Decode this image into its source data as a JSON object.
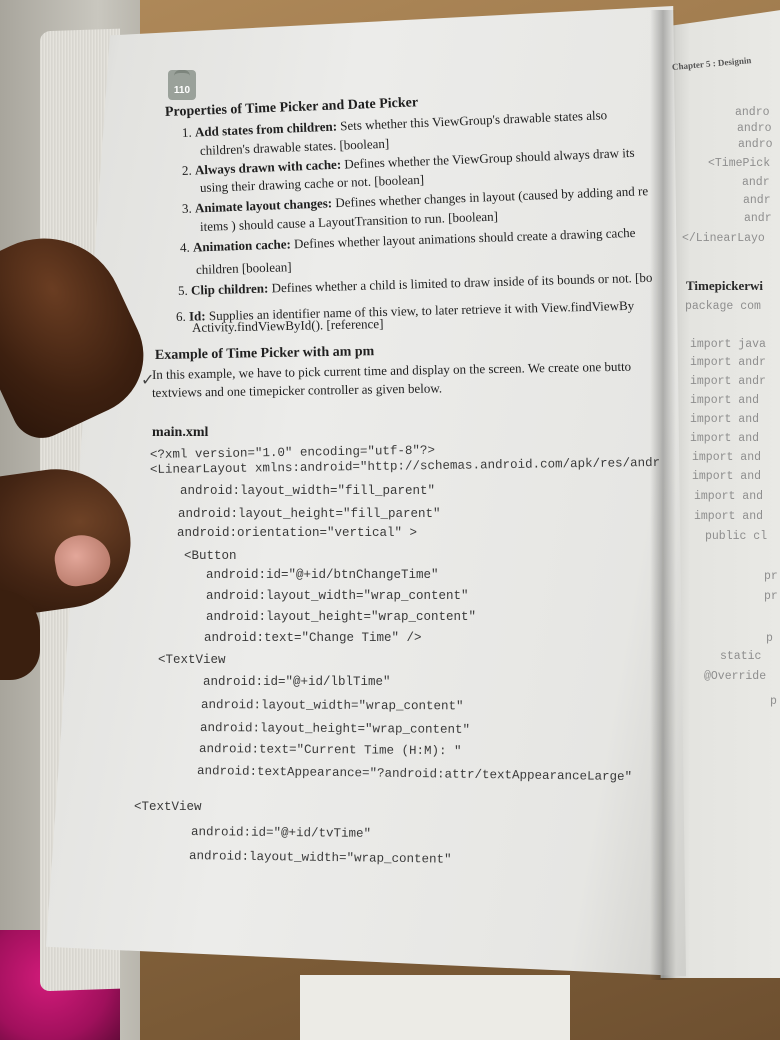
{
  "page_number": "110",
  "header_right": "Chapter 5 : Designin",
  "section_title": "Properties of Time Picker and Date Picker",
  "properties": [
    {
      "num": "1.",
      "term": "Add states from children:",
      "text": " Sets whether this ViewGroup's drawable states also ",
      "cont": "children's drawable states. [boolean]"
    },
    {
      "num": "2.",
      "term": "Always drawn with cache:",
      "text": " Defines whether the ViewGroup should always draw its ",
      "cont": "using their drawing cache or not. [boolean]"
    },
    {
      "num": "3.",
      "term": "Animate layout changes:",
      "text": " Defines whether changes in layout (caused by adding and re",
      "cont": "items ) should cause a LayoutTransition to run. [boolean]"
    },
    {
      "num": "4.",
      "term": "Animation cache:",
      "text": " Defines whether layout animations should create a drawing cache",
      "cont": "children [boolean]"
    },
    {
      "num": "5.",
      "term": "Clip children:",
      "text": " Defines whether a child is limited to draw inside of its bounds or not. [bo",
      "cont": ""
    },
    {
      "num": "6.",
      "term": "Id:",
      "text": " Supplies an identifier name of this view, to later retrieve it with View.findViewBy",
      "cont": "Activity.findViewById(). [reference]"
    }
  ],
  "example_title": "Example of Time  Picker with am pm",
  "example_text_1": "In this example, we have to pick current time and display on the screen. We create one butto",
  "example_text_2": "textviews and one timepicker controller as given below.",
  "file_name": "main.xml",
  "code_lines": [
    "<?xml version=\"1.0\" encoding=\"utf-8\"?>",
    "<LinearLayout xmlns:android=\"http://schemas.android.com/apk/res/andr",
    "android:layout_width=\"fill_parent\"",
    "android:layout_height=\"fill_parent\"",
    "android:orientation=\"vertical\" >",
    "<Button",
    "android:id=\"@+id/btnChangeTime\"",
    "android:layout_width=\"wrap_content\"",
    "android:layout_height=\"wrap_content\"",
    "android:text=\"Change Time\" />",
    "<TextView",
    "android:id=\"@+id/lblTime\"",
    "android:layout_width=\"wrap_content\"",
    "android:layout_height=\"wrap_content\"",
    "android:text=\"Current Time (H:M): \"",
    "android:textAppearance=\"?android:attr/textAppearanceLarge\"",
    "<TextView",
    "android:id=\"@+id/tvTime\"",
    "android:layout_width=\"wrap_content\""
  ],
  "right_page": {
    "code_top": [
      "andro",
      "andro",
      "andro",
      "<TimePick",
      "andr",
      "andr",
      "andr",
      "</LinearLayo"
    ],
    "heading": "Timepickerwi",
    "package": "package com",
    "imports": [
      "import java",
      "import andr",
      "import andr",
      "import and",
      "import and",
      "import and",
      "import and",
      "import and",
      "import and",
      "import and"
    ],
    "class_line": "public cl",
    "members": [
      "pr",
      "pr",
      "p",
      "static",
      "@Override",
      "p"
    ]
  }
}
